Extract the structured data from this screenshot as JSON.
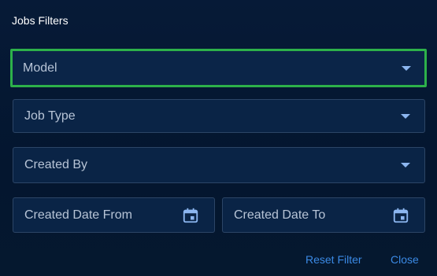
{
  "dialog": {
    "title": "Jobs Filters"
  },
  "filters": {
    "model": {
      "label": "Model",
      "icon": "chevron-down-icon"
    },
    "job_type": {
      "label": "Job Type",
      "icon": "chevron-down-icon"
    },
    "created_by": {
      "label": "Created By",
      "icon": "chevron-down-icon"
    },
    "created_date_from": {
      "label": "Created Date From",
      "icon": "calendar-icon"
    },
    "created_date_to": {
      "label": "Created Date To",
      "icon": "calendar-icon"
    }
  },
  "actions": {
    "reset_label": "Reset Filter",
    "close_label": "Close"
  },
  "colors": {
    "background": "#051a36",
    "field_background": "#0a2446",
    "field_border": "#2c4566",
    "focus_border": "#2db14a",
    "accent": "#3b8ae5",
    "icon": "#8cb6f0"
  }
}
